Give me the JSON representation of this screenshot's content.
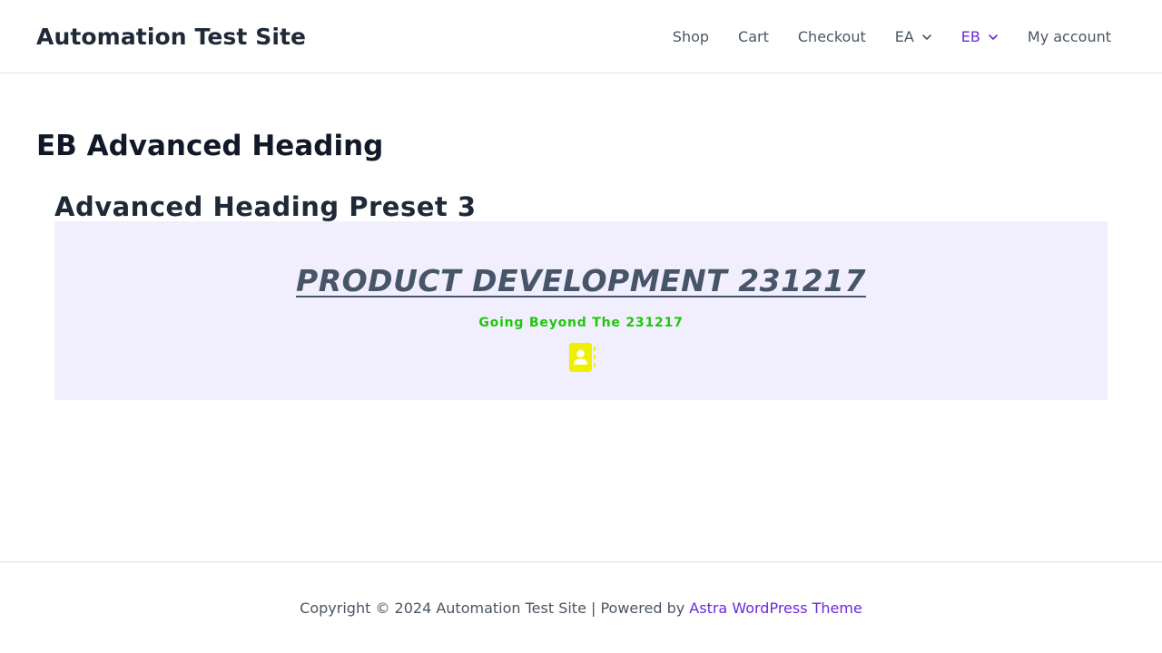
{
  "header": {
    "site_title": "Automation Test Site",
    "nav": [
      {
        "label": "Shop",
        "has_dropdown": false,
        "active": false
      },
      {
        "label": "Cart",
        "has_dropdown": false,
        "active": false
      },
      {
        "label": "Checkout",
        "has_dropdown": false,
        "active": false
      },
      {
        "label": "EA",
        "has_dropdown": true,
        "active": false
      },
      {
        "label": "EB",
        "has_dropdown": true,
        "active": true
      },
      {
        "label": "My account",
        "has_dropdown": false,
        "active": false
      }
    ]
  },
  "main": {
    "page_title": "EB Advanced Heading",
    "section_heading": "Advanced Heading Preset 3",
    "advanced_heading": {
      "title": "PRODUCT DEVELOPMENT 231217",
      "subtitle": "Going Beyond The 231217",
      "icon": "address-book-icon",
      "background_color": "#f1effd",
      "title_color": "#475569",
      "subtitle_color": "#22c50f",
      "icon_color": "#eef000"
    }
  },
  "footer": {
    "copyright_text": "Copyright © 2024 Automation Test Site | Powered by ",
    "link_text": "Astra WordPress Theme"
  },
  "colors": {
    "accent": "#6d28d9",
    "text": "#4b5563",
    "heading": "#111827"
  }
}
